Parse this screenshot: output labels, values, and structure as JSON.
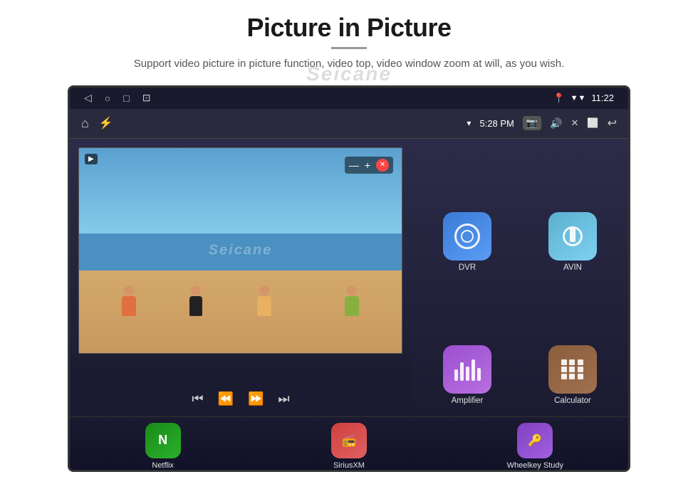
{
  "page": {
    "title": "Picture in Picture",
    "subtitle": "Support video picture in picture function, video top, video window zoom at will, as you wish.",
    "watermark": "Seicane"
  },
  "status_bar": {
    "back_label": "◁",
    "home_label": "○",
    "recent_label": "□",
    "screenshot_label": "⊡",
    "signal_label": "▼▼",
    "time": "11:22"
  },
  "toolbar": {
    "home_icon": "⌂",
    "usb_icon": "⚡",
    "wifi_label": "▾",
    "time": "5:28 PM",
    "camera_icon": "📷",
    "volume_icon": "🔊",
    "close_icon": "✕",
    "window_icon": "⬜",
    "back_icon": "↩"
  },
  "pip": {
    "minimize_label": "—",
    "expand_label": "+",
    "close_label": "✕",
    "play_icon": "▶"
  },
  "media_controls": {
    "prev_label": "⏮",
    "rewind_label": "⏪",
    "forward_label": "⏩",
    "next_label": "⏭"
  },
  "apps": [
    {
      "id": "dvr",
      "label": "DVR",
      "color": "dvr"
    },
    {
      "id": "avin",
      "label": "AVIN",
      "color": "avin"
    },
    {
      "id": "amplifier",
      "label": "Amplifier",
      "color": "amplifier"
    },
    {
      "id": "calculator",
      "label": "Calculator",
      "color": "calculator"
    }
  ],
  "dock": [
    {
      "id": "netflix",
      "label": "Netflix",
      "color": "netflix"
    },
    {
      "id": "siriusxm",
      "label": "SiriusXM",
      "color": "sirius"
    },
    {
      "id": "wheelkey",
      "label": "Wheelkey Study",
      "color": "wheelkey"
    }
  ]
}
